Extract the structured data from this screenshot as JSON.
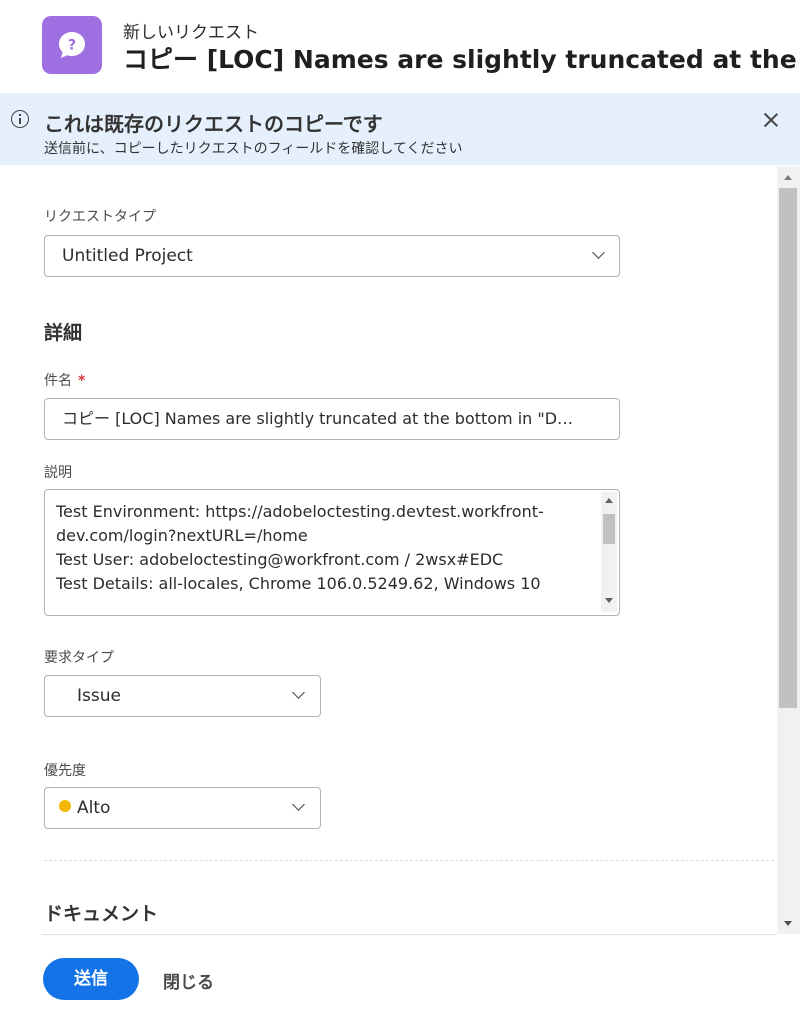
{
  "header": {
    "subtitle": "新しいリクエスト",
    "title": "コピー [LOC] Names are slightly truncated at the bo",
    "icon": "help-bubble-icon",
    "icon_color": "#9d6fe0"
  },
  "banner": {
    "title": "これは既存のリクエストのコピーです",
    "text": "送信前に、コピーしたリクエストのフィールドを確認してください",
    "icon": "info-icon",
    "close_icon": "close-icon",
    "background": "#e5f0fc"
  },
  "form": {
    "request_type": {
      "label": "リクエストタイプ",
      "value": "Untitled Project"
    },
    "details_heading": "詳細",
    "subject": {
      "label": "件名",
      "required_mark": "*",
      "value": "コピー [LOC] Names are slightly truncated at the bottom in \"D…"
    },
    "description": {
      "label": "説明",
      "lines": [
        "Test Environment: https://adobeloctesting.devtest.workfront-",
        "dev.com/login?nextURL=/home",
        "Test User: adobeloctesting@workfront.com / 2wsx#EDC",
        "Test Details: all-locales, Chrome 106.0.5249.62, Windows 10"
      ]
    },
    "issue_type": {
      "label": "要求タイプ",
      "value": "Issue"
    },
    "priority": {
      "label": "優先度",
      "value": "Alto",
      "dot_color": "#f5b800"
    },
    "documents_heading": "ドキュメント"
  },
  "footer": {
    "submit_label": "送信",
    "close_label": "閉じる",
    "accent": "#1473e6"
  }
}
